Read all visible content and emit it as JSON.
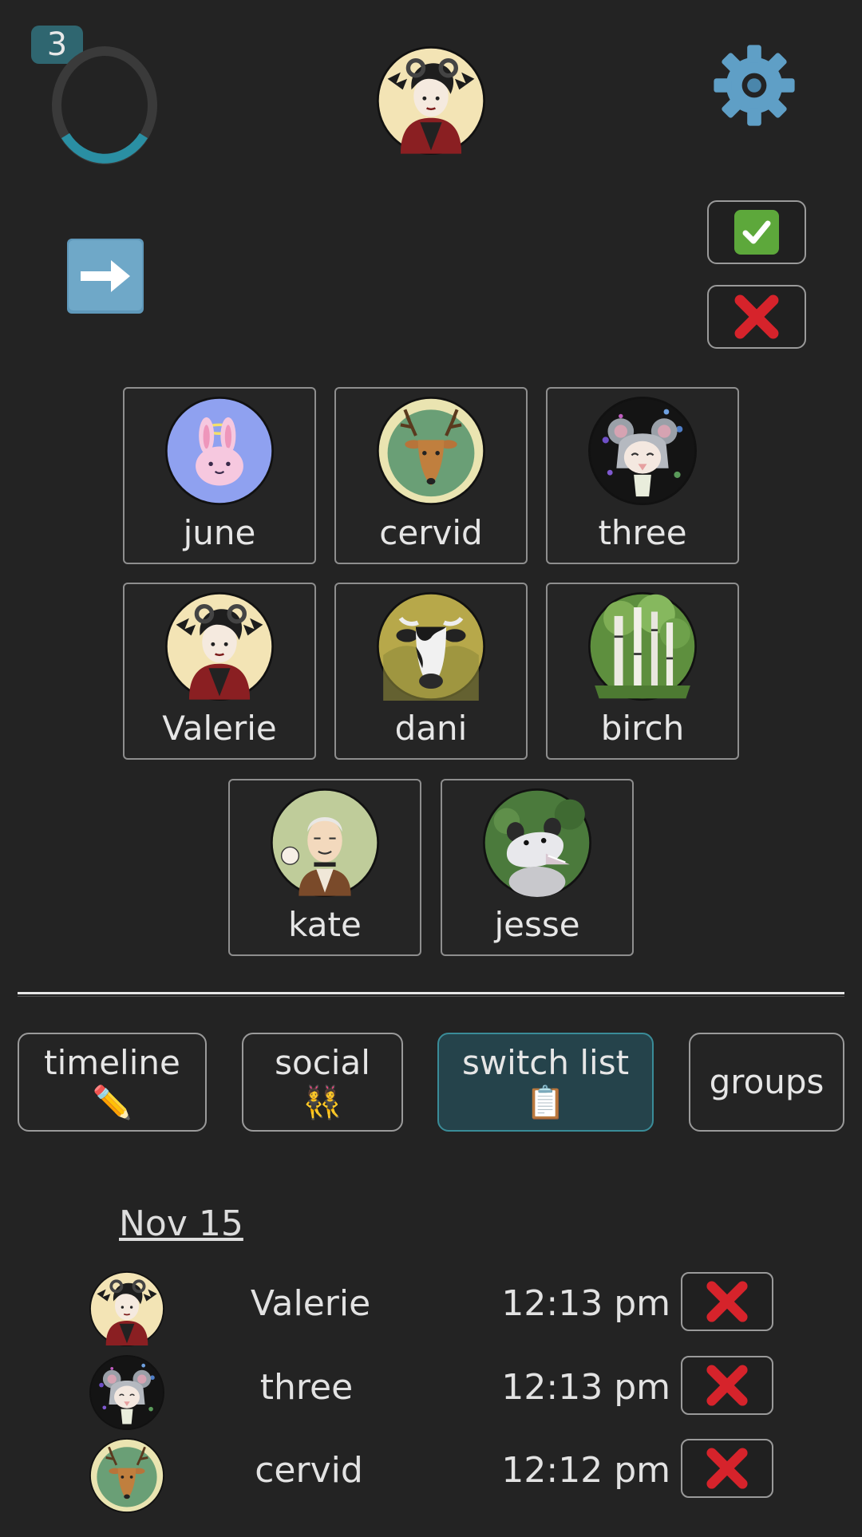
{
  "header": {
    "badge_count": "3",
    "ring_progress": 0.25,
    "ring_color": "#2a8fa3",
    "settings_icon": "gear-icon",
    "current_fronter_avatar": "valerie-avatar",
    "confirm_icon": "check-icon",
    "cancel_icon": "cross-icon",
    "next_icon": "arrow-right-icon"
  },
  "members": [
    {
      "name": "june",
      "avatar": "bunny-avatar"
    },
    {
      "name": "cervid",
      "avatar": "deer-avatar"
    },
    {
      "name": "three",
      "avatar": "mouse-girl-avatar"
    },
    {
      "name": "Valerie",
      "avatar": "horned-girl-avatar"
    },
    {
      "name": "dani",
      "avatar": "cow-avatar"
    },
    {
      "name": "birch",
      "avatar": "birch-trees-avatar"
    },
    {
      "name": "kate",
      "avatar": "old-man-avatar"
    },
    {
      "name": "jesse",
      "avatar": "opossum-avatar"
    }
  ],
  "tabs": [
    {
      "label": "timeline",
      "emoji": "✏️",
      "active": false
    },
    {
      "label": "social",
      "emoji": "👯",
      "active": false
    },
    {
      "label": "switch list",
      "emoji": "📋",
      "active": true
    },
    {
      "label": "groups",
      "emoji": "",
      "active": false
    }
  ],
  "switch_list": {
    "date": "Nov 15",
    "entries": [
      {
        "name": "Valerie",
        "time": "12:13 pm",
        "avatar": "horned-girl-avatar"
      },
      {
        "name": "three",
        "time": "12:13 pm",
        "avatar": "mouse-girl-avatar"
      },
      {
        "name": "cervid",
        "time": "12:12 pm",
        "avatar": "deer-avatar"
      }
    ]
  },
  "colors": {
    "background": "#232323",
    "accent": "#2a8fa3",
    "active_tab": "#25434b",
    "delete_red": "#d6232b",
    "check_green": "#5da83b"
  }
}
